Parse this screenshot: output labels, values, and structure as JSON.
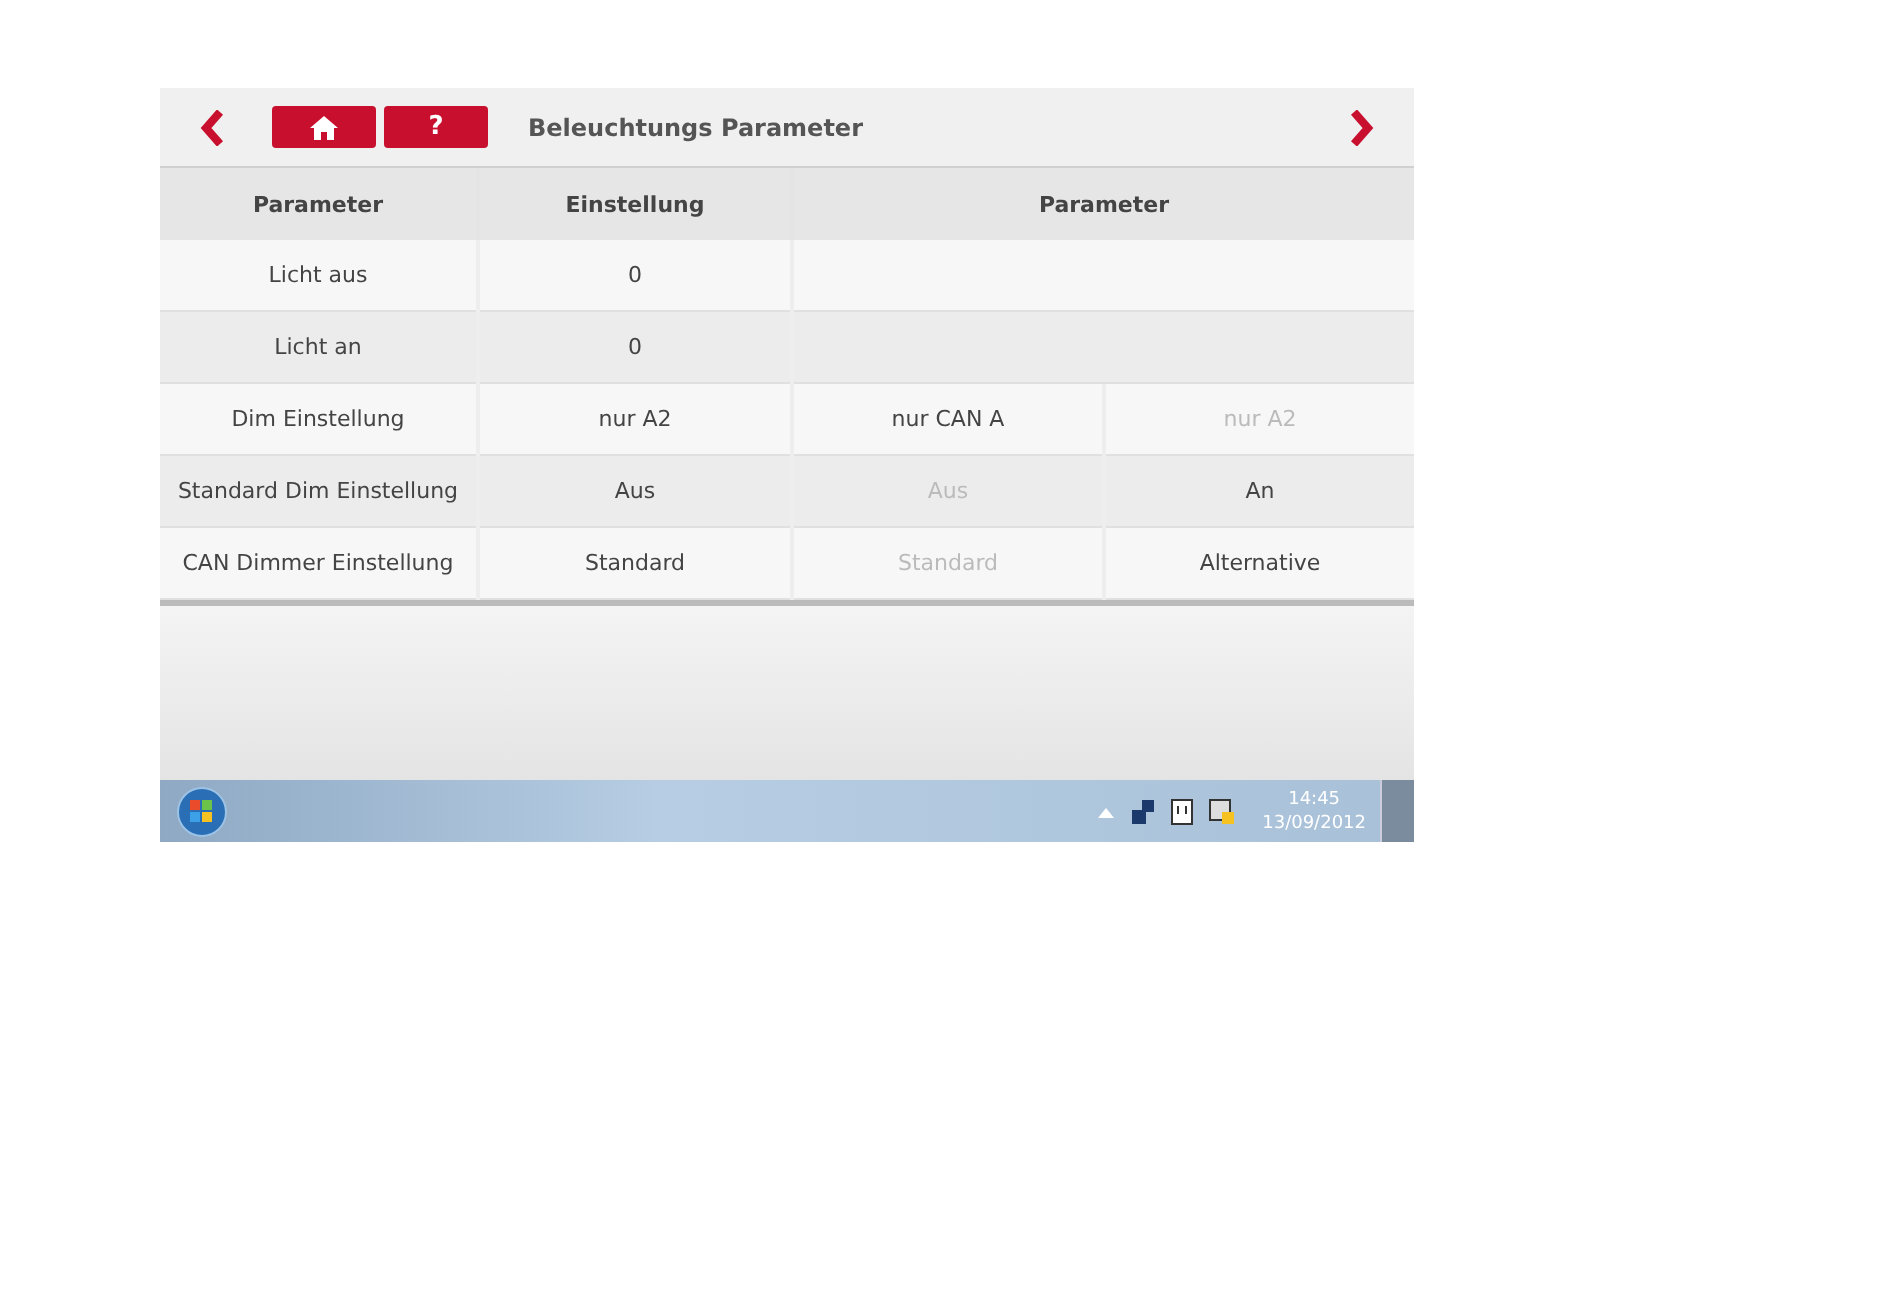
{
  "header": {
    "help_label": "?",
    "title": "Beleuchtungs Parameter"
  },
  "table": {
    "columns": [
      "Parameter",
      "Einstellung",
      "Parameter"
    ],
    "rows": [
      {
        "name": "Licht aus",
        "value": "0",
        "options": []
      },
      {
        "name": "Licht an",
        "value": "0",
        "options": []
      },
      {
        "name": "Dim Einstellung",
        "value": "nur A2",
        "options": [
          {
            "label": "nur CAN A",
            "disabled": false
          },
          {
            "label": "nur A2",
            "disabled": true
          }
        ]
      },
      {
        "name": "Standard Dim Einstellung",
        "value": "Aus",
        "options": [
          {
            "label": "Aus",
            "disabled": true
          },
          {
            "label": "An",
            "disabled": false
          }
        ]
      },
      {
        "name": "CAN Dimmer Einstellung",
        "value": "Standard",
        "options": [
          {
            "label": "Standard",
            "disabled": true
          },
          {
            "label": "Alternative",
            "disabled": false
          }
        ]
      }
    ]
  },
  "taskbar": {
    "time": "14:45",
    "date": "13/09/2012"
  }
}
